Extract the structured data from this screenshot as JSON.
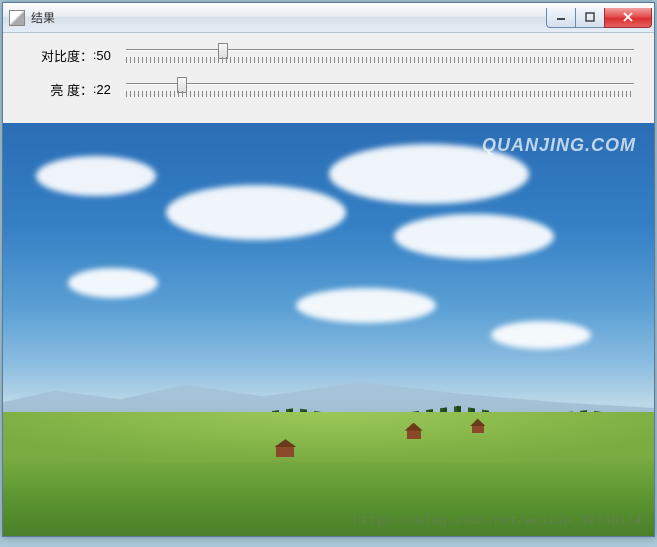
{
  "window": {
    "title": "结果"
  },
  "sliders": {
    "contrast": {
      "label": "对比度：",
      "value": "50",
      "position": 19
    },
    "brightness": {
      "label": "亮  度：",
      "value": "22",
      "position": 11
    }
  },
  "image": {
    "watermark": "QUANJING.COM",
    "blog_watermark": "https://blog.csdn.net/weixin_39746114"
  }
}
